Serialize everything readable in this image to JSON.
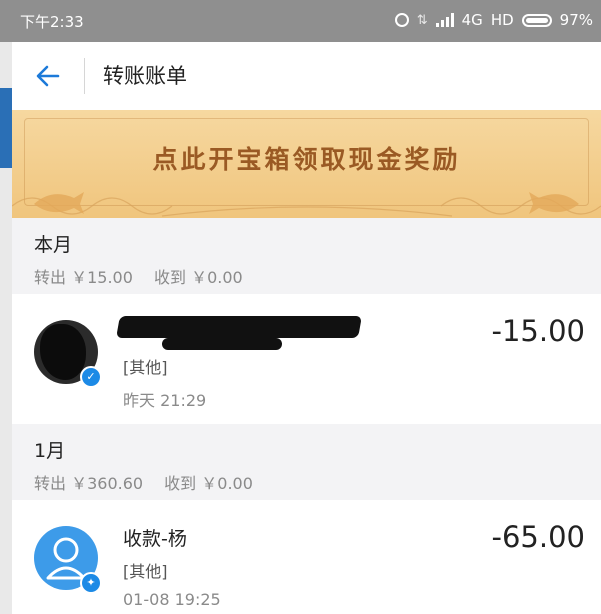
{
  "status_bar": {
    "time": "下午2:33",
    "network": "4G",
    "hd": "HD",
    "battery": "97%"
  },
  "nav": {
    "title": "转账账单"
  },
  "banner": {
    "text": "点此开宝箱领取现金奖励"
  },
  "sections": [
    {
      "title": "本月",
      "transfer_out": "转出 ￥15.00",
      "received": "收到 ￥0.00",
      "records": [
        {
          "category": "[其他]",
          "time": "昨天  21:29",
          "amount": "-15.00"
        }
      ]
    },
    {
      "title": "1月",
      "transfer_out": "转出 ￥360.60",
      "received": "收到 ￥0.00",
      "records": [
        {
          "name": "收款-杨",
          "category": "[其他]",
          "time": "01-08  19:25",
          "amount": "-65.00"
        }
      ]
    }
  ],
  "colors": {
    "accent": "#1c7ad9",
    "banner": "#f0c57d",
    "banner_text": "#9a5a24",
    "section_bg": "#f3f3f5"
  }
}
